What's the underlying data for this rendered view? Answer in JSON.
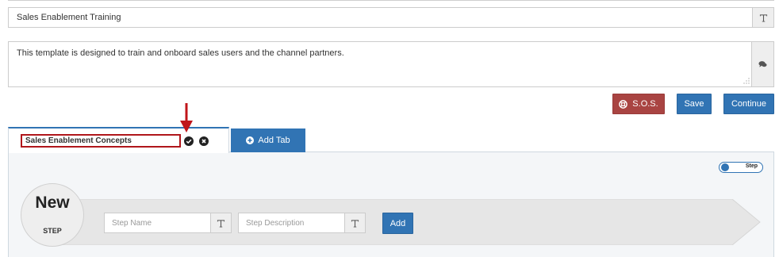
{
  "template": {
    "title_value": "Sales Enablement Training",
    "title_icon": "text-format-icon",
    "description_value": "This template is designed to train and onboard sales users and the channel partners.",
    "description_icon": "comments-icon"
  },
  "actions": {
    "sos_label": "S.O.S.",
    "save_label": "Save",
    "continue_label": "Continue"
  },
  "tabs": {
    "active_tab_name": "Sales Enablement Concepts",
    "add_tab_label": "Add Tab"
  },
  "toggle": {
    "label": "Step"
  },
  "new_step": {
    "title": "New",
    "subtitle": "STEP",
    "name_placeholder": "Step Name",
    "description_placeholder": "Step Description",
    "add_label": "Add"
  },
  "colors": {
    "primary": "#3174b4",
    "danger": "#a94442",
    "highlight": "#b0161b"
  }
}
